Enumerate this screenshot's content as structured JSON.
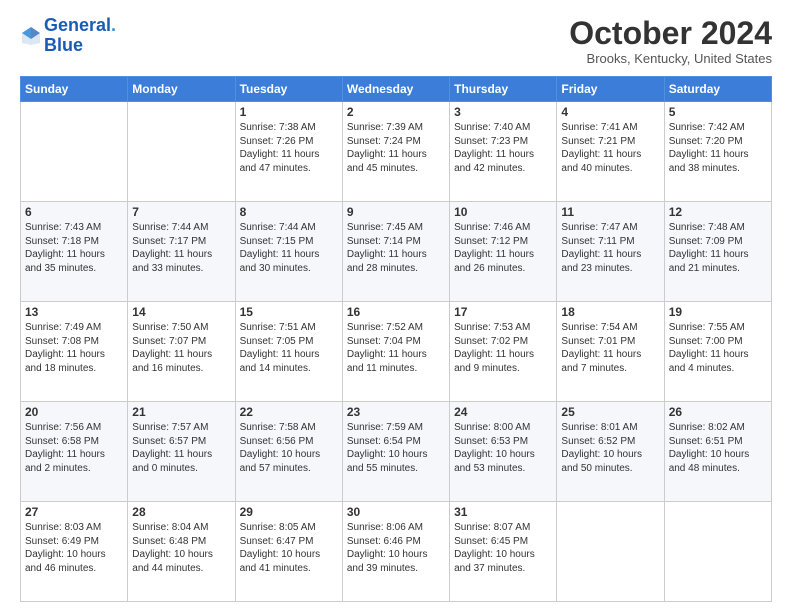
{
  "header": {
    "logo_line1": "General",
    "logo_line2": "Blue",
    "month": "October 2024",
    "location": "Brooks, Kentucky, United States"
  },
  "days_of_week": [
    "Sunday",
    "Monday",
    "Tuesday",
    "Wednesday",
    "Thursday",
    "Friday",
    "Saturday"
  ],
  "weeks": [
    [
      {
        "day": "",
        "info": ""
      },
      {
        "day": "",
        "info": ""
      },
      {
        "day": "1",
        "info": "Sunrise: 7:38 AM\nSunset: 7:26 PM\nDaylight: 11 hours and 47 minutes."
      },
      {
        "day": "2",
        "info": "Sunrise: 7:39 AM\nSunset: 7:24 PM\nDaylight: 11 hours and 45 minutes."
      },
      {
        "day": "3",
        "info": "Sunrise: 7:40 AM\nSunset: 7:23 PM\nDaylight: 11 hours and 42 minutes."
      },
      {
        "day": "4",
        "info": "Sunrise: 7:41 AM\nSunset: 7:21 PM\nDaylight: 11 hours and 40 minutes."
      },
      {
        "day": "5",
        "info": "Sunrise: 7:42 AM\nSunset: 7:20 PM\nDaylight: 11 hours and 38 minutes."
      }
    ],
    [
      {
        "day": "6",
        "info": "Sunrise: 7:43 AM\nSunset: 7:18 PM\nDaylight: 11 hours and 35 minutes."
      },
      {
        "day": "7",
        "info": "Sunrise: 7:44 AM\nSunset: 7:17 PM\nDaylight: 11 hours and 33 minutes."
      },
      {
        "day": "8",
        "info": "Sunrise: 7:44 AM\nSunset: 7:15 PM\nDaylight: 11 hours and 30 minutes."
      },
      {
        "day": "9",
        "info": "Sunrise: 7:45 AM\nSunset: 7:14 PM\nDaylight: 11 hours and 28 minutes."
      },
      {
        "day": "10",
        "info": "Sunrise: 7:46 AM\nSunset: 7:12 PM\nDaylight: 11 hours and 26 minutes."
      },
      {
        "day": "11",
        "info": "Sunrise: 7:47 AM\nSunset: 7:11 PM\nDaylight: 11 hours and 23 minutes."
      },
      {
        "day": "12",
        "info": "Sunrise: 7:48 AM\nSunset: 7:09 PM\nDaylight: 11 hours and 21 minutes."
      }
    ],
    [
      {
        "day": "13",
        "info": "Sunrise: 7:49 AM\nSunset: 7:08 PM\nDaylight: 11 hours and 18 minutes."
      },
      {
        "day": "14",
        "info": "Sunrise: 7:50 AM\nSunset: 7:07 PM\nDaylight: 11 hours and 16 minutes."
      },
      {
        "day": "15",
        "info": "Sunrise: 7:51 AM\nSunset: 7:05 PM\nDaylight: 11 hours and 14 minutes."
      },
      {
        "day": "16",
        "info": "Sunrise: 7:52 AM\nSunset: 7:04 PM\nDaylight: 11 hours and 11 minutes."
      },
      {
        "day": "17",
        "info": "Sunrise: 7:53 AM\nSunset: 7:02 PM\nDaylight: 11 hours and 9 minutes."
      },
      {
        "day": "18",
        "info": "Sunrise: 7:54 AM\nSunset: 7:01 PM\nDaylight: 11 hours and 7 minutes."
      },
      {
        "day": "19",
        "info": "Sunrise: 7:55 AM\nSunset: 7:00 PM\nDaylight: 11 hours and 4 minutes."
      }
    ],
    [
      {
        "day": "20",
        "info": "Sunrise: 7:56 AM\nSunset: 6:58 PM\nDaylight: 11 hours and 2 minutes."
      },
      {
        "day": "21",
        "info": "Sunrise: 7:57 AM\nSunset: 6:57 PM\nDaylight: 11 hours and 0 minutes."
      },
      {
        "day": "22",
        "info": "Sunrise: 7:58 AM\nSunset: 6:56 PM\nDaylight: 10 hours and 57 minutes."
      },
      {
        "day": "23",
        "info": "Sunrise: 7:59 AM\nSunset: 6:54 PM\nDaylight: 10 hours and 55 minutes."
      },
      {
        "day": "24",
        "info": "Sunrise: 8:00 AM\nSunset: 6:53 PM\nDaylight: 10 hours and 53 minutes."
      },
      {
        "day": "25",
        "info": "Sunrise: 8:01 AM\nSunset: 6:52 PM\nDaylight: 10 hours and 50 minutes."
      },
      {
        "day": "26",
        "info": "Sunrise: 8:02 AM\nSunset: 6:51 PM\nDaylight: 10 hours and 48 minutes."
      }
    ],
    [
      {
        "day": "27",
        "info": "Sunrise: 8:03 AM\nSunset: 6:49 PM\nDaylight: 10 hours and 46 minutes."
      },
      {
        "day": "28",
        "info": "Sunrise: 8:04 AM\nSunset: 6:48 PM\nDaylight: 10 hours and 44 minutes."
      },
      {
        "day": "29",
        "info": "Sunrise: 8:05 AM\nSunset: 6:47 PM\nDaylight: 10 hours and 41 minutes."
      },
      {
        "day": "30",
        "info": "Sunrise: 8:06 AM\nSunset: 6:46 PM\nDaylight: 10 hours and 39 minutes."
      },
      {
        "day": "31",
        "info": "Sunrise: 8:07 AM\nSunset: 6:45 PM\nDaylight: 10 hours and 37 minutes."
      },
      {
        "day": "",
        "info": ""
      },
      {
        "day": "",
        "info": ""
      }
    ]
  ]
}
